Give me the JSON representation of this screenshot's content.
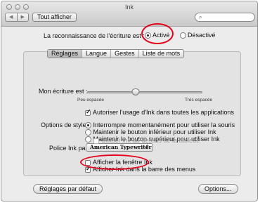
{
  "window": {
    "title": "Ink",
    "nav_back": "◀",
    "nav_forward": "▶",
    "show_all": "Tout afficher",
    "search_icon": "magnifier-icon",
    "search_glyph": "⌕"
  },
  "recognition": {
    "label": "La reconnaissance de l'écriture est :",
    "active": "Activé",
    "inactive": "Désactivé",
    "selected": "Activé"
  },
  "tabs": [
    "Réglages",
    "Langue",
    "Gestes",
    "Liste de mots"
  ],
  "selected_tab": "Réglages",
  "handwriting": {
    "label": "Mon écriture est :",
    "min_label": "Peu espacée",
    "max_label": "Très espacée",
    "level": 0.42
  },
  "allow_ink_anywhere": {
    "label": "Autoriser l'usage d'Ink dans toutes les applications",
    "checked": true
  },
  "stylus": {
    "label": "Options de stylet :",
    "options": [
      "Interrompre momentanément pour utiliser la souris",
      "Maintenir le bouton inférieur pour utiliser Ink",
      "Maintenir le bouton supérieur pour utiliser Ink"
    ],
    "selected_index": 0,
    "over_tablet": {
      "label": "Utiliser Ink au-dessus de la tablette",
      "checked": false,
      "enabled": false
    }
  },
  "ink_pad": {
    "label": "Police Ink pad :",
    "value": "American Typewriter",
    "arrows": "⇕"
  },
  "show_ink_window": {
    "label": "Afficher la fenêtre Ink",
    "checked": false
  },
  "show_in_menubar": {
    "label": "Afficher Ink dans la barre des menus",
    "checked": true
  },
  "buttons": {
    "defaults": "Réglages par défaut",
    "options": "Options..."
  },
  "colors": {
    "highlight_circle": "#e3001b"
  }
}
